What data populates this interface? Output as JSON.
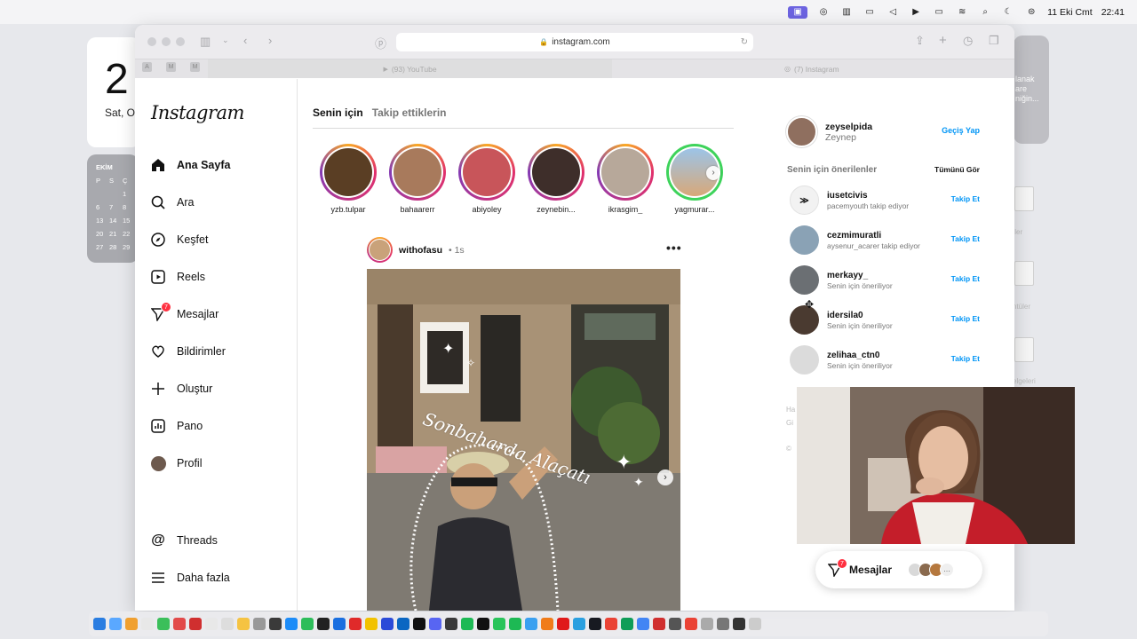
{
  "menubar": {
    "date": "11 Eki Cmt",
    "time": "22:41"
  },
  "desktop": {
    "clock_big": "2",
    "clock_small": "Sat, O",
    "calendar_month": "EKİM",
    "calendar_days": [
      "P",
      "S",
      "Ç",
      "",
      "",
      "1",
      "6",
      "7",
      "8",
      "13",
      "14",
      "15",
      "20",
      "21",
      "22",
      "27",
      "28",
      "29"
    ],
    "right_widget_text": "lanak\nare\nniğin...",
    "labels": [
      "ıler",
      "ntüler",
      "elgeleri"
    ]
  },
  "browser": {
    "url": "instagram.com",
    "tabs": [
      {
        "label": "(93) YouTube"
      },
      {
        "label": "(7) Instagram"
      }
    ],
    "pinned": [
      "A",
      "M",
      "M"
    ]
  },
  "instagram": {
    "logo": "Instagram",
    "nav": [
      {
        "label": "Ana Sayfa",
        "icon": "home-icon",
        "active": true
      },
      {
        "label": "Ara",
        "icon": "search-icon"
      },
      {
        "label": "Keşfet",
        "icon": "explore-icon"
      },
      {
        "label": "Reels",
        "icon": "reels-icon"
      },
      {
        "label": "Mesajlar",
        "icon": "messages-icon",
        "badge": "7"
      },
      {
        "label": "Bildirimler",
        "icon": "heart-icon"
      },
      {
        "label": "Oluştur",
        "icon": "plus-icon"
      },
      {
        "label": "Pano",
        "icon": "dashboard-icon"
      },
      {
        "label": "Profil",
        "icon": "profile-avatar-icon"
      }
    ],
    "nav_bottom": [
      {
        "label": "Threads",
        "icon": "threads-icon"
      },
      {
        "label": "Daha fazla",
        "icon": "menu-icon"
      }
    ],
    "feed_tabs": {
      "for_you": "Senin için",
      "following": "Takip ettiklerin"
    },
    "stories": [
      {
        "user": "yzb.tulpar",
        "color": "#5a3e24",
        "ring": "gradient"
      },
      {
        "user": "bahaarerr",
        "color": "#a87a5c",
        "ring": "gradient"
      },
      {
        "user": "abiyoley",
        "color": "#c8555a",
        "ring": "gradient"
      },
      {
        "user": "zeynebin...",
        "color": "#3e2e2a",
        "ring": "gradient"
      },
      {
        "user": "ikrasgim_",
        "color": "#b7a89a",
        "ring": "gradient"
      },
      {
        "user": "yagmurar...",
        "color": "#8bb3d9",
        "ring": "green"
      }
    ],
    "post": {
      "user": "withofasu",
      "time": "1s",
      "overlay_text": "Sonbaharda Alaçatı"
    },
    "me": {
      "username": "zeyselpida",
      "name": "Zeynep",
      "switch": "Geçiş Yap"
    },
    "suggestions_title": "Senin için önerilenler",
    "see_all": "Tümünü Gör",
    "suggestions": [
      {
        "user": "iusetcivis",
        "sub": "pacemyouth takip ediyor",
        "action": "Takip Et",
        "color": "#f2f2f2"
      },
      {
        "user": "cezmimuratli",
        "sub": "aysenur_acarer takip ediyor",
        "action": "Takip Et",
        "color": "#8aa2b5"
      },
      {
        "user": "merkayy_",
        "sub": "Senin için öneriliyor",
        "action": "Takip Et",
        "color": "#6b6f73"
      },
      {
        "user": "idersila0",
        "sub": "Senin için öneriliyor",
        "action": "Takip Et",
        "color": "#4a3a30"
      },
      {
        "user": "zelihaa_ctn0",
        "sub": "Senin için öneriliyor",
        "action": "Takip Et",
        "color": "#dbdbdb"
      }
    ],
    "footer": [
      "Ha",
      "Gi",
      "©"
    ],
    "messages_pill": {
      "label": "Mesajlar",
      "badge": "7"
    }
  },
  "colors": {
    "accent": "#0095f6",
    "badge": "#ff3040"
  }
}
